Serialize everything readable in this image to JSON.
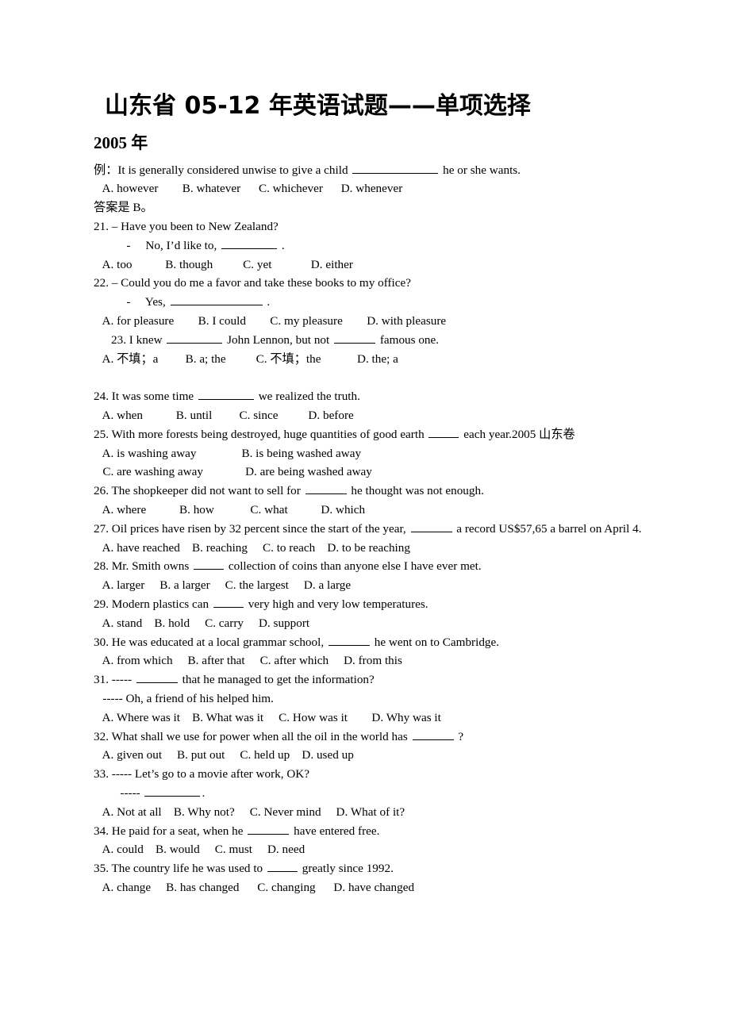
{
  "document": {
    "title": "山东省 05-12 年英语试题——单项选择",
    "year_heading": "2005 年"
  },
  "example": {
    "stem_prefix": "例：It is generally considered unwise to give a child ",
    "stem_suffix": " he or she wants.",
    "options": "   A. however        B. whatever      C. whichever      D. whenever",
    "answer_line": "答案是 B。"
  },
  "questions": [
    {
      "id": "21",
      "stem": "21. – Have you been to New Zealand?",
      "reply_prefix": "   -     No, I’d like to, ",
      "reply_suffix": " .",
      "options": "   A. too           B. though          C. yet             D. either"
    },
    {
      "id": "22",
      "stem": "22. – Could you do me a favor and take these books to my office?",
      "reply_prefix": "   -     Yes, ",
      "reply_suffix": " .",
      "options": "   A. for pleasure        B. I could        C. my pleasure        D. with pleasure"
    },
    {
      "id": "23",
      "stem_a": "23. I knew ",
      "stem_b": " John Lennon, but not ",
      "stem_c": " famous one.",
      "options": "   A. 不填；a         B. a; the          C. 不填；the            D. the; a"
    },
    {
      "id": "24",
      "stem_a": "24. It was some time ",
      "stem_b": " we realized the truth.",
      "options": "   A. when           B. until         C. since          D. before"
    },
    {
      "id": "25",
      "stem_a": "25. With more forests being destroyed, huge quantities of good earth ",
      "stem_b": " each year.2005 山东卷",
      "options_1": "   A. is washing away               B. is being washed away",
      "options_2": "   C. are washing away              D. are being washed away"
    },
    {
      "id": "26",
      "stem_a": "26. The shopkeeper did not want to sell for ",
      "stem_b": " he thought was not enough.",
      "options": "   A. where           B. how            C. what           D. which"
    },
    {
      "id": "27",
      "stem_a": "27. Oil prices have risen by 32 percent since the start of the year, ",
      "stem_b": " a record US$57,65 a barrel on April 4.",
      "options": "   A. have reached    B. reaching     C. to reach    D. to be reaching"
    },
    {
      "id": "28",
      "stem_a": "28. Mr. Smith owns ",
      "stem_b": " collection of coins than anyone else I have ever met.",
      "options": "   A. larger     B. a larger     C. the largest     D. a large"
    },
    {
      "id": "29",
      "stem_a": "29. Modern plastics can ",
      "stem_b": " very high and very low temperatures.",
      "options": "   A. stand    B. hold     C. carry     D. support"
    },
    {
      "id": "30",
      "stem_a": "30. He was educated at a local grammar school, ",
      "stem_b": " he went on to Cambridge.",
      "options": "   A. from which     B. after that     C. after which     D. from this"
    },
    {
      "id": "31",
      "stem_a": "31. ----- ",
      "stem_b": " that he managed to get the information?",
      "reply": "   ----- Oh, a friend of his helped him.",
      "options": "   A. Where was it    B. What was it     C. How was it        D. Why was it"
    },
    {
      "id": "32",
      "stem_a": "32. What shall we use for power when all the oil in the world has ",
      "stem_b": " ?",
      "options": "   A. given out     B. put out     C. held up    D. used up"
    },
    {
      "id": "33",
      "stem": "33. ----- Let’s go to a movie after work, OK?",
      "reply_prefix": "   ----- ",
      "reply_suffix": ".",
      "options": "   A. Not at all    B. Why not?     C. Never mind     D. What of it?"
    },
    {
      "id": "34",
      "stem_a": "34. He paid for a seat, when he ",
      "stem_b": " have entered free.",
      "options": "   A. could    B. would     C. must     D. need"
    },
    {
      "id": "35",
      "stem_a": "35. The country life he was used to ",
      "stem_b": " greatly since 1992.",
      "options": "   A. change     B. has changed      C. changing      D. have changed"
    }
  ]
}
